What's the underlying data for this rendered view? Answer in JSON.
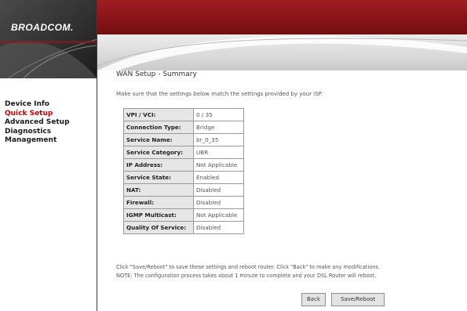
{
  "brand": {
    "logo_text": "BROADCOM."
  },
  "colors": {
    "accent": "#8a1a1a",
    "active_nav": "#cc0000"
  },
  "sidebar": {
    "items": [
      {
        "label": "Device Info",
        "active": false
      },
      {
        "label": "Quick Setup",
        "active": true
      },
      {
        "label": "Advanced Setup",
        "active": false
      },
      {
        "label": "Diagnostics",
        "active": false
      },
      {
        "label": "Management",
        "active": false
      }
    ]
  },
  "main": {
    "title": "WAN Setup - Summary",
    "intro": "Make sure that the settings below match the settings provided by your ISP.",
    "rows": [
      {
        "label": "VPI / VCI:",
        "value": "0 / 35"
      },
      {
        "label": "Connection Type:",
        "value": "Bridge"
      },
      {
        "label": "Service Name:",
        "value": "br_0_35"
      },
      {
        "label": "Service Category:",
        "value": "UBR"
      },
      {
        "label": "IP Address:",
        "value": "Not Applicable"
      },
      {
        "label": "Service State:",
        "value": "Enabled"
      },
      {
        "label": "NAT:",
        "value": "Disabled"
      },
      {
        "label": "Firewall:",
        "value": "Disabled"
      },
      {
        "label": "IGMP Multicast:",
        "value": "Not Applicable"
      },
      {
        "label": "Quality Of Service:",
        "value": "Disabled"
      }
    ],
    "note_line1": "Click \"Save/Reboot\" to save these settings and reboot router. Click \"Back\" to make any modifications.",
    "note_line2": "NOTE: The configuration process takes about 1 minute to complete and your DSL Router will reboot.",
    "back_label": "Back",
    "save_reboot_label": "Save/Reboot"
  }
}
